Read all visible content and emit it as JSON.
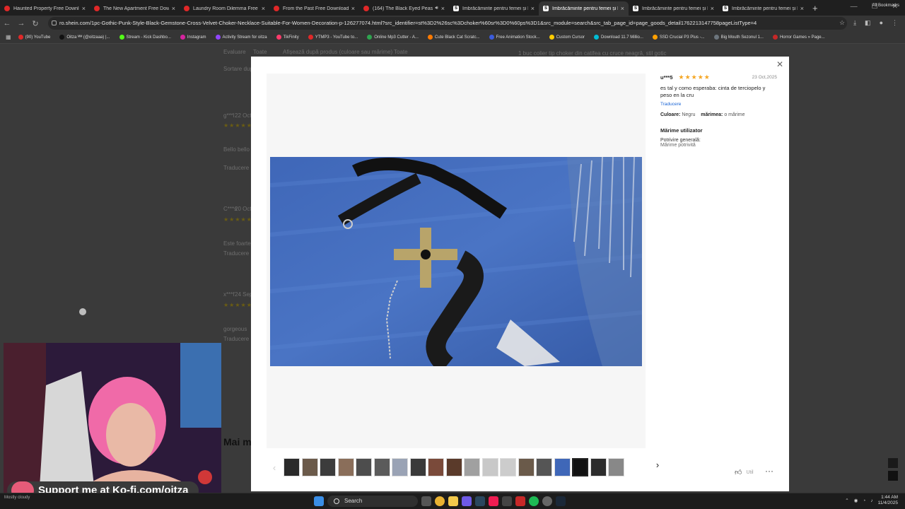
{
  "browser": {
    "tabs": [
      {
        "title": "Haunted Property Free Download",
        "favicon": "youtube-icon",
        "color": "#e02828"
      },
      {
        "title": "The New Apartment Free Downlo",
        "favicon": "youtube-icon",
        "color": "#e02828"
      },
      {
        "title": "Laundry Room Dilemma Free Dow",
        "favicon": "youtube-icon",
        "color": "#e02828"
      },
      {
        "title": "From the Past Free Download » St",
        "favicon": "youtube-icon",
        "color": "#e02828"
      },
      {
        "title": "(164) The Black Eyed Peas Top",
        "favicon": "youtube-icon",
        "color": "#e02828",
        "audio": true
      },
      {
        "title": "Îmbrăcăminte pentru femei și băr",
        "favicon": "shein-icon",
        "color": "#ffffff"
      },
      {
        "title": "Îmbrăcăminte pentru femei și băr",
        "favicon": "shein-icon",
        "color": "#ffffff",
        "active": true
      },
      {
        "title": "Îmbrăcăminte pentru femei și băr",
        "favicon": "shein-icon",
        "color": "#ffffff"
      },
      {
        "title": "Îmbrăcăminte pentru femei și băr",
        "favicon": "shein-icon",
        "color": "#ffffff"
      }
    ],
    "url": "ro.shein.com/1pc-Gothic-Punk-Style-Black-Gemstone-Cross-Velvet-Choker-Necklace-Suitable-For-Women-Decoration-p-126277074.html?src_identifier=st%3D2%26sc%3Dchoker%60sr%3D0%60ps%3D1&src_module=search&src_tab_page_id=page_goods_detail1762213147758pageListType=4",
    "bookmarks": [
      {
        "label": "(90) YouTube",
        "color": "#e02828"
      },
      {
        "label": "Oitza ᴹᴹ (@oitzaaa) |...",
        "color": "#111111"
      },
      {
        "label": "Stream - Kick Dashbo...",
        "color": "#53fc18"
      },
      {
        "label": "Instagram",
        "color": "#d6249f"
      },
      {
        "label": "Activity Stream for oitza",
        "color": "#9146ff"
      },
      {
        "label": "TikFinity",
        "color": "#ff3b6b"
      },
      {
        "label": "YTMP3 - YouTube to...",
        "color": "#e02828"
      },
      {
        "label": "Online Mp3 Cutter - A...",
        "color": "#2ea44f"
      },
      {
        "label": "Cute Black Cat Scratc...",
        "color": "#ff7a00"
      },
      {
        "label": "Free Animation Stock...",
        "color": "#3b5bdb"
      },
      {
        "label": "Custom Cursor",
        "color": "#ffcc00"
      },
      {
        "label": "Download 11.7 Millio...",
        "color": "#00bcd4"
      },
      {
        "label": "SSD Crucial P3 Plus -...",
        "color": "#ffa000"
      },
      {
        "label": "Big Mouth Sezonul 1...",
        "color": "#6c757d"
      },
      {
        "label": "Horror Games » Page...",
        "color": "#c62828"
      }
    ],
    "all_bookmarks": "All Bookmarks"
  },
  "background_page": {
    "filter_evaluare": "Evaluare",
    "filter_toate1": "Toate",
    "filter_afiseaza": "Afișează după produs (culoare sau mărime)",
    "filter_toate2": "Toate",
    "product_link": "1 buc colier tip choker din catifea cu cruce neagră, stil gotic",
    "sort_label": "Sortare după",
    "reviews": [
      {
        "user": "g***l",
        "date": "22 Oct",
        "text": "Bello bello bello bello",
        "translate": "Traducere"
      },
      {
        "user": "C***s",
        "date": "20 Oct",
        "text": "Este foarte",
        "translate": "Traducere"
      },
      {
        "user": "x***f",
        "date": "24 Sep",
        "text": "gorgeous",
        "translate": "Traducere"
      }
    ],
    "main_label": "Mai m"
  },
  "modal": {
    "review": {
      "user": "u***5",
      "rating": 5,
      "date": "23 Oct,2025",
      "text": "es tal y como esperaba: cinta de terciopelo y peso en la cru",
      "translate": "Traducere",
      "color_label": "Culoare:",
      "color_value": "Negru",
      "size_label": "mărimea:",
      "size_value": "o mărime",
      "user_size_title": "Mărime utilizator",
      "fit_label": "Potrivire generală:",
      "fit_value": "Mărime potrivită"
    },
    "like_label": "Util",
    "thumbnails_count": 19,
    "selected_thumbnail": 16
  },
  "stream": {
    "kofi_text": "Support me at Ko-fi.com/oitza"
  },
  "taskbar": {
    "weather": "Mostly cloudy",
    "search_placeholder": "Search",
    "time": "1:44 AM",
    "date": "11/4/2025"
  }
}
